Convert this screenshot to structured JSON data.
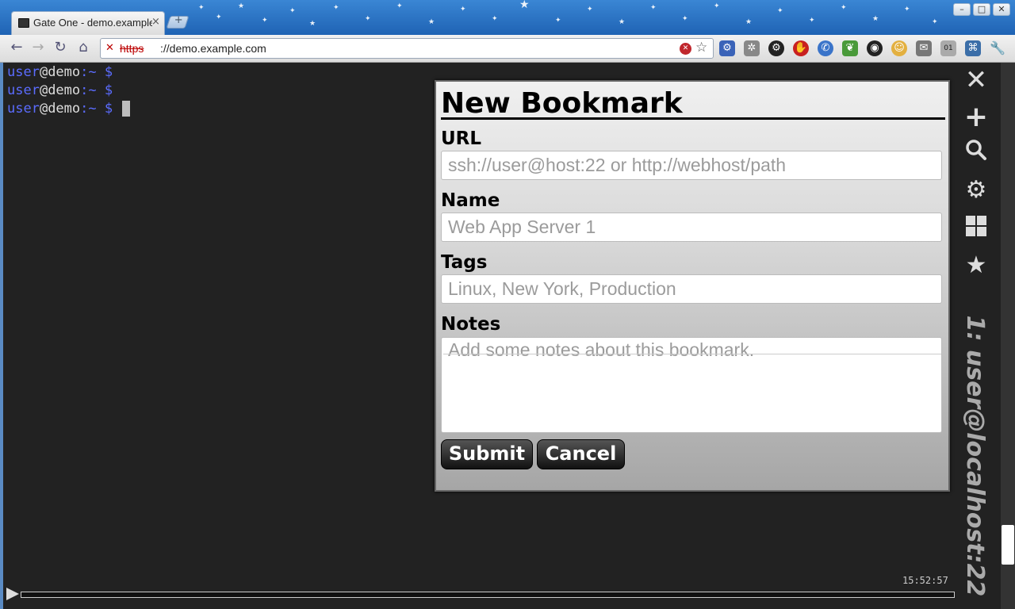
{
  "browser": {
    "tab_title": "Gate One - demo.example.com",
    "tab_close": "×",
    "new_tab": "+",
    "url_protocol": "https",
    "url_rest": "://demo.example.com",
    "window_buttons": {
      "minimize": "–",
      "maximize": "□",
      "close": "✕"
    }
  },
  "terminal": {
    "lines": [
      {
        "user": "user",
        "host": "@demo",
        "path": ":~ $"
      },
      {
        "user": "user",
        "host": "@demo",
        "path": ":~ $"
      },
      {
        "user": "user",
        "host": "@demo",
        "path": ":~ $"
      }
    ],
    "title": "1: user@localhost:22",
    "clock": "15:52:57"
  },
  "sidebar": {
    "icons": [
      "close-icon",
      "new-terminal-icon",
      "search-icon",
      "settings-icon",
      "grid-view-icon",
      "bookmarks-icon"
    ]
  },
  "dialog": {
    "title": "New Bookmark",
    "url_label": "URL",
    "url_placeholder": "ssh://user@host:22 or http://webhost/path",
    "name_label": "Name",
    "name_placeholder": "Web App Server 1",
    "tags_label": "Tags",
    "tags_placeholder": "Linux, New York, Production",
    "notes_label": "Notes",
    "notes_placeholder": "Add some notes about this bookmark.",
    "submit_label": "Submit",
    "cancel_label": "Cancel"
  },
  "colors": {
    "titlebar": "#2a72c4",
    "terminal_bg": "#222222",
    "prompt_user": "#5b6cff",
    "dialog_button": "#222222"
  }
}
